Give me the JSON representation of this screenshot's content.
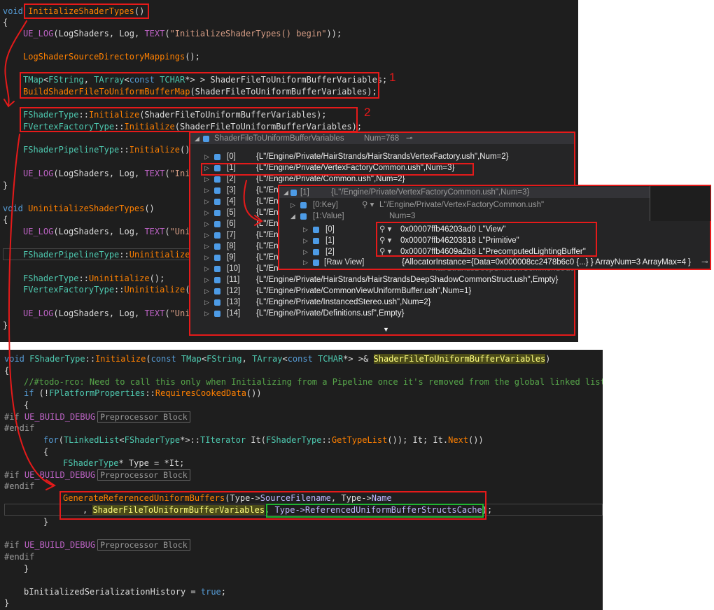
{
  "top_code": {
    "l1": "void",
    "l1b": "InitializeShaderTypes",
    "l1c": "()",
    "l2": "{",
    "ue_log": "UE_LOG",
    "log_shaders": "LogShaders",
    "log": "Log",
    "text_macro": "TEXT",
    "begin_str": "\"InitializeShaderTypes() begin\"",
    "mappings": "LogShaderSourceDirectoryMappings",
    "tmap": "TMap",
    "fstring": "FString",
    "tarray": "TArray",
    "const_kw": "const",
    "tchar": "TCHAR",
    "var": "ShaderFileToUniformBufferVariables",
    "build": "BuildShaderFileToUniformBufferMap",
    "fshadertype": "FShaderType",
    "initialize": "Initialize",
    "fvertex": "FVertexFactoryType",
    "fpipeline": "FShaderPipelineType",
    "init_partial": "\"Initia",
    "uninit_fn": "UninitializeShaderTypes",
    "uninit_partial": "\"Uninit",
    "uninitialize": "Uninitialize",
    "close": "}"
  },
  "annotations": {
    "n1": "1",
    "n2": "2"
  },
  "watch": {
    "header_name": "ShaderFileToUniformBufferVariables",
    "header_value": "Num=768",
    "items": [
      {
        "idx": "[0]",
        "val": "{L\"/Engine/Private/HairStrands/HairStrandsVertexFactory.ush\",Num=2}"
      },
      {
        "idx": "[1]",
        "val": "{L\"/Engine/Private/VertexFactoryCommon.ush\",Num=3}"
      },
      {
        "idx": "[2]",
        "val": "{L\"/Engine/Private/Common.ush\",Num=2}"
      },
      {
        "idx": "[3]",
        "val": "{L\"/En"
      },
      {
        "idx": "[4]",
        "val": "{L\"/En"
      },
      {
        "idx": "[5]",
        "val": "{L\"/En"
      },
      {
        "idx": "[6]",
        "val": "{L\"/En"
      },
      {
        "idx": "[7]",
        "val": "{L\"/En"
      },
      {
        "idx": "[8]",
        "val": "{L\"/En"
      },
      {
        "idx": "[9]",
        "val": "{L\"/En"
      },
      {
        "idx": "[10]",
        "val": "{L\"/En"
      },
      {
        "idx": "[11]",
        "val": "{L\"/Engine/Private/HairStrands/HairStrandsDeepShadowCommonStruct.ush\",Empty}"
      },
      {
        "idx": "[12]",
        "val": "{L\"/Engine/Private/CommonViewUniformBuffer.ush\",Num=1}"
      },
      {
        "idx": "[13]",
        "val": "{L\"/Engine/Private/InstancedStereo.ush\",Num=2}"
      },
      {
        "idx": "[14]",
        "val": "{L\"/Engine/Private/Definitions.usf\",Empty}"
      }
    ],
    "row10_tail": "HairStrandsDeepShadowCommonStruct.ush\",Empty}"
  },
  "sub_watch": {
    "header_idx": "[1]",
    "header_val": "{L\"/Engine/Private/VertexFactoryCommon.ush\",Num=3}",
    "key_label": "[0:Key]",
    "key_val": "L\"/Engine/Private/VertexFactoryCommon.ush\"",
    "value_label": "[1:Value]",
    "value_val": "Num=3",
    "entries": [
      {
        "idx": "[0]",
        "val": "0x00007ffb46203ad0 L\"View\""
      },
      {
        "idx": "[1]",
        "val": "0x00007ffb46203818 L\"Primitive\""
      },
      {
        "idx": "[2]",
        "val": "0x00007ffb4609a2b8 L\"PrecomputedLightingBuffer\""
      }
    ],
    "raw_label": "[Raw View]",
    "raw_val": "{AllocatorInstance={Data=0x000008cc2478b6c0 {...} } ArrayNum=3 ArrayMax=4 }"
  },
  "bottom_code": {
    "void_kw": "void",
    "fshadertype": "FShaderType",
    "initialize": "Initialize",
    "sig_rest_a": "(const ",
    "tmap": "TMap",
    "fstring": "FString",
    "tarray": "TArray",
    "const_kw": "const",
    "tchar": "TCHAR",
    "param": "ShaderFileToUniformBufferVariables",
    "comment": "//#todo-rco: Need to call this only when Initializing from a Pipeline once it's removed from the global linked list",
    "if_kw": "if",
    "fplatform": "FPlatformProperties",
    "requires": "RequiresCookedData",
    "if_hash": "#if",
    "ue_build_debug": "UE_BUILD_DEBUG",
    "preproc_block": "Preprocessor Block",
    "endif": "#endif",
    "for_kw": "for",
    "tlinkedlist": "TLinkedList",
    "titerator": "TIterator",
    "it_decl": " It(",
    "gettypelist": "GetTypeList",
    "it_rest": "()); It; It.",
    "next": "Next",
    "star_type": "* Type = *It;",
    "genref": "GenerateReferencedUniformBuffers",
    "type_src": "(Type->",
    "source_filename": "SourceFilename",
    "type_name": ", Type->",
    "name_field": "Name",
    "comma": ", ",
    "cache": "Type->ReferencedUniformBufferStructsCache",
    "cache_end": ");",
    "binit": "bInitializedSerializationHistory",
    "true_kw": "true",
    "eq": " = ",
    "semi": ";"
  },
  "colors": {
    "red": "#e51a1a",
    "green": "#1fb531",
    "editor_bg": "#1e1e1e",
    "debug_bg": "#252526"
  }
}
